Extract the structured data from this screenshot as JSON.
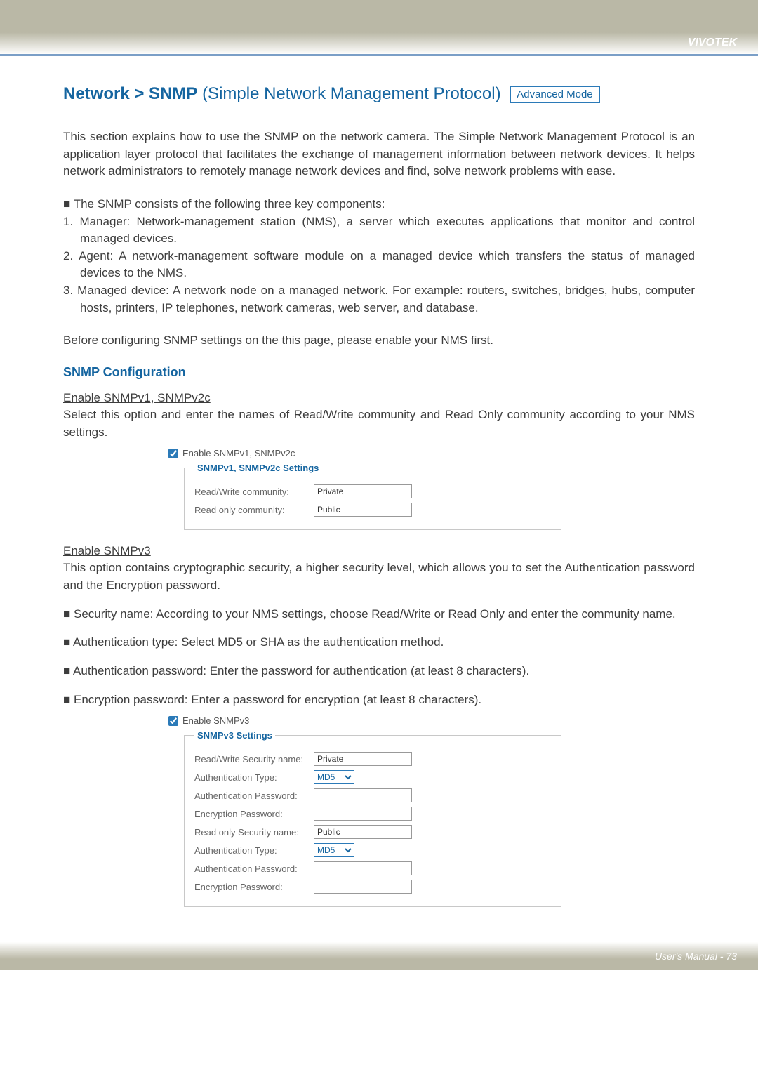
{
  "header": {
    "brand": "VIVOTEK"
  },
  "title": {
    "breadcrumb": "Network > SNMP",
    "subtitle": "(Simple Network Management Protocol)",
    "badge": "Advanced Mode"
  },
  "intro": "This section explains how to use the SNMP on the network camera. The Simple Network Management Protocol is an application layer protocol that facilitates the exchange of management information between network devices. It helps network administrators to remotely manage network devices and find, solve network problems with ease.",
  "components_intro": "■ The SNMP consists of the following three key components:",
  "components": [
    "1. Manager: Network-management station (NMS), a server which executes applications that monitor and control managed devices.",
    "2. Agent: A network-management software module on a managed device which transfers the status of managed devices to the NMS.",
    "3. Managed device: A network node on a managed network. For example: routers, switches, bridges, hubs, computer hosts, printers, IP telephones, network cameras, web server, and database."
  ],
  "before_note": "Before configuring SNMP settings on the this page, please enable your NMS first.",
  "config_heading": "SNMP Configuration",
  "v1v2c": {
    "heading": "Enable SNMPv1, SNMPv2c",
    "desc": "Select this option and enter the names of Read/Write community and Read Only community according to your NMS settings.",
    "checkbox_label": "Enable SNMPv1, SNMPv2c",
    "legend": "SNMPv1, SNMPv2c Settings",
    "rw_label": "Read/Write community:",
    "rw_value": "Private",
    "ro_label": "Read only community:",
    "ro_value": "Public"
  },
  "v3": {
    "heading": "Enable SNMPv3",
    "desc": "This option contains cryptographic security, a higher security level, which allows you to set the Authentication password and the Encryption password.",
    "bullets": [
      "■ Security name: According to your NMS settings, choose Read/Write or Read Only and enter the community name.",
      "■ Authentication type: Select MD5 or SHA as the authentication method.",
      "■ Authentication password: Enter the password for authentication (at least 8 characters).",
      "■ Encryption password: Enter a password for encryption (at least 8 characters)."
    ],
    "checkbox_label": "Enable SNMPv3",
    "legend": "SNMPv3 Settings",
    "rw_sec_label": "Read/Write Security name:",
    "rw_sec_value": "Private",
    "auth_type_label": "Authentication Type:",
    "auth_type_value": "MD5",
    "auth_pw_label": "Authentication Password:",
    "enc_pw_label": "Encryption Password:",
    "ro_sec_label": "Read only Security name:",
    "ro_sec_value": "Public"
  },
  "footer": {
    "text": "User's Manual - 73"
  }
}
